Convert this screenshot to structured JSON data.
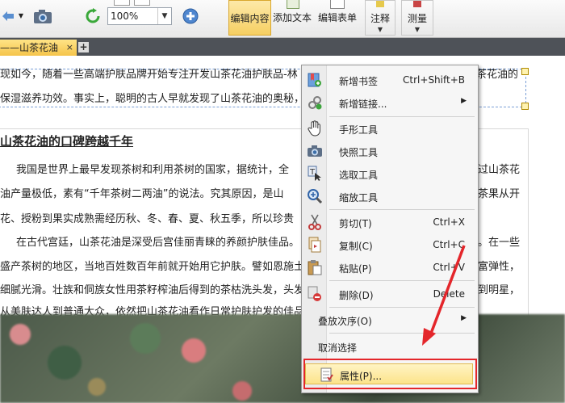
{
  "toolbar": {
    "zoom_value": "100%",
    "edit_content_label": "编辑内容",
    "add_text_label": "添加文本",
    "edit_form_label": "编辑表单",
    "annotate_label": "注释",
    "measure_label": "测量"
  },
  "tabs": [
    {
      "label": "——山茶花油",
      "close": "×"
    }
  ],
  "tab_add": "+",
  "document": {
    "intro_line1": "现如今，随着一些高端护肤品牌开始专注开发山茶花油护肤品-林",
    "intro_line1_tail": "茶花油的",
    "intro_line2": "保湿滋养功效。事实上，聪明的古人早就发现了山茶花油的奥秘，",
    "heading": "山茶花油的口碑跨越千年",
    "para1_line1": "我国是世界上最早发现茶树和利用茶树的国家，据统计，全",
    "para1_line1_tail": "过山茶花",
    "para1_line2": "油产量极低，素有“千年茶树二两油”的说法。究其原因，是山",
    "para1_line2_tail": "茶果从开",
    "para1_line3": "花、授粉到果实成熟需经历秋、冬、春、夏、秋五季，所以珍贵",
    "para2_line1": "在古代宫廷，山茶花油是深受后宫佳丽青睐的养颜护肤佳品。",
    "para2_line1_tail": "。在一些",
    "para2_line2": "盛产茶树的地区，当地百姓数百年前就开始用它护肤。譬如恩施土",
    "para2_line2_tail": "富弹性，",
    "para2_line3": "细腻光滑。壮族和侗族女性用茶籽榨油后得到的茶枯洗头发，头发",
    "para2_line3_tail": "到明星，",
    "para2_line4": "从美肤达人到普通大众，依然把山茶花油看作日常护肤护发的佳品"
  },
  "context_menu": {
    "items": [
      {
        "label": "新增书签",
        "shortcut": "Ctrl+Shift+B",
        "icon": "bookmark-icon"
      },
      {
        "label": "新增链接...",
        "submenu": "▶",
        "icon": "link-icon"
      },
      {
        "label": "手形工具",
        "icon": "hand-icon"
      },
      {
        "label": "快照工具",
        "icon": "camera-icon"
      },
      {
        "label": "选取工具",
        "icon": "text-select-icon"
      },
      {
        "label": "缩放工具",
        "icon": "zoom-icon"
      },
      {
        "label": "剪切(T)",
        "shortcut": "Ctrl+X",
        "icon": "scissors-icon"
      },
      {
        "label": "复制(C)",
        "shortcut": "Ctrl+C",
        "icon": "copy-icon"
      },
      {
        "label": "粘贴(P)",
        "shortcut": "Ctrl+V",
        "icon": "paste-icon"
      },
      {
        "label": "删除(D)",
        "shortcut": "Delete",
        "icon": "delete-icon"
      },
      {
        "label": "叠放次序(O)",
        "submenu": "▶"
      },
      {
        "label": "取消选择"
      },
      {
        "label": "属性(P)...",
        "icon": "properties-icon",
        "highlighted": true
      }
    ]
  },
  "colors": {
    "highlight_box": "#e4262b",
    "arrow": "#e4262b",
    "tab_active": "#f5c44a"
  }
}
